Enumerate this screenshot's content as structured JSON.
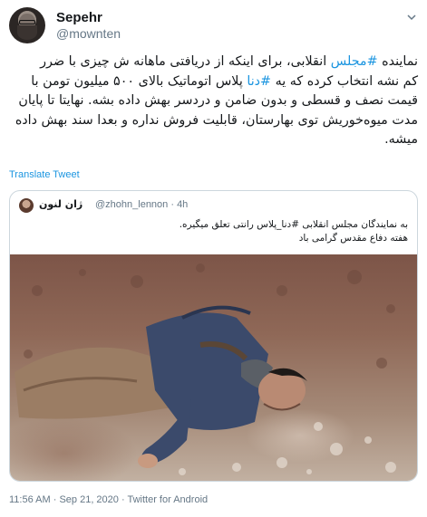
{
  "author": {
    "name": "Sepehr",
    "handle": "@mownten"
  },
  "tweet": {
    "line1_pre": "نماینده ",
    "line1_tag": "#مجلس",
    "line1_post": " انقلابی، برای اینکه از دریافتی ماهانه ش چیزی با ضرر",
    "line2_pre": "کم نشه انتخاب کرده که یه ",
    "line2_tag": "#دنا",
    "line2_post": " پلاس اتوماتیک بالای ۵۰۰ میلیون تومن با",
    "line3": "قیمت نصف و قسطی و بدون ضامن و دردسر بهش داده بشه. نهایتا تا پایان",
    "line4": "مدت میوه‌خوریش توی بهارستان، قابلیت فروش نداره و بعدا سند بهش داده",
    "line5": "میشه."
  },
  "translate_label": "Translate Tweet",
  "quoted": {
    "name": "ژان لنون",
    "handle_time": "@zhohn_lennon · 4h",
    "line1": "به نمایندگان مجلس انقلابی #دنا_پلاس رانتی تعلق میگیره.",
    "line2": "هفته دفاع مقدس گرامی باد"
  },
  "meta": {
    "time": "11:56 AM",
    "sep1": " · ",
    "date": "Sep 21, 2020",
    "sep2": " · ",
    "source": "Twitter for Android"
  },
  "colors": {
    "link": "#1b95e0",
    "secondary_text": "#657786",
    "border": "#ccd6dd"
  },
  "icons": {
    "menu": "chevron-down-icon"
  }
}
